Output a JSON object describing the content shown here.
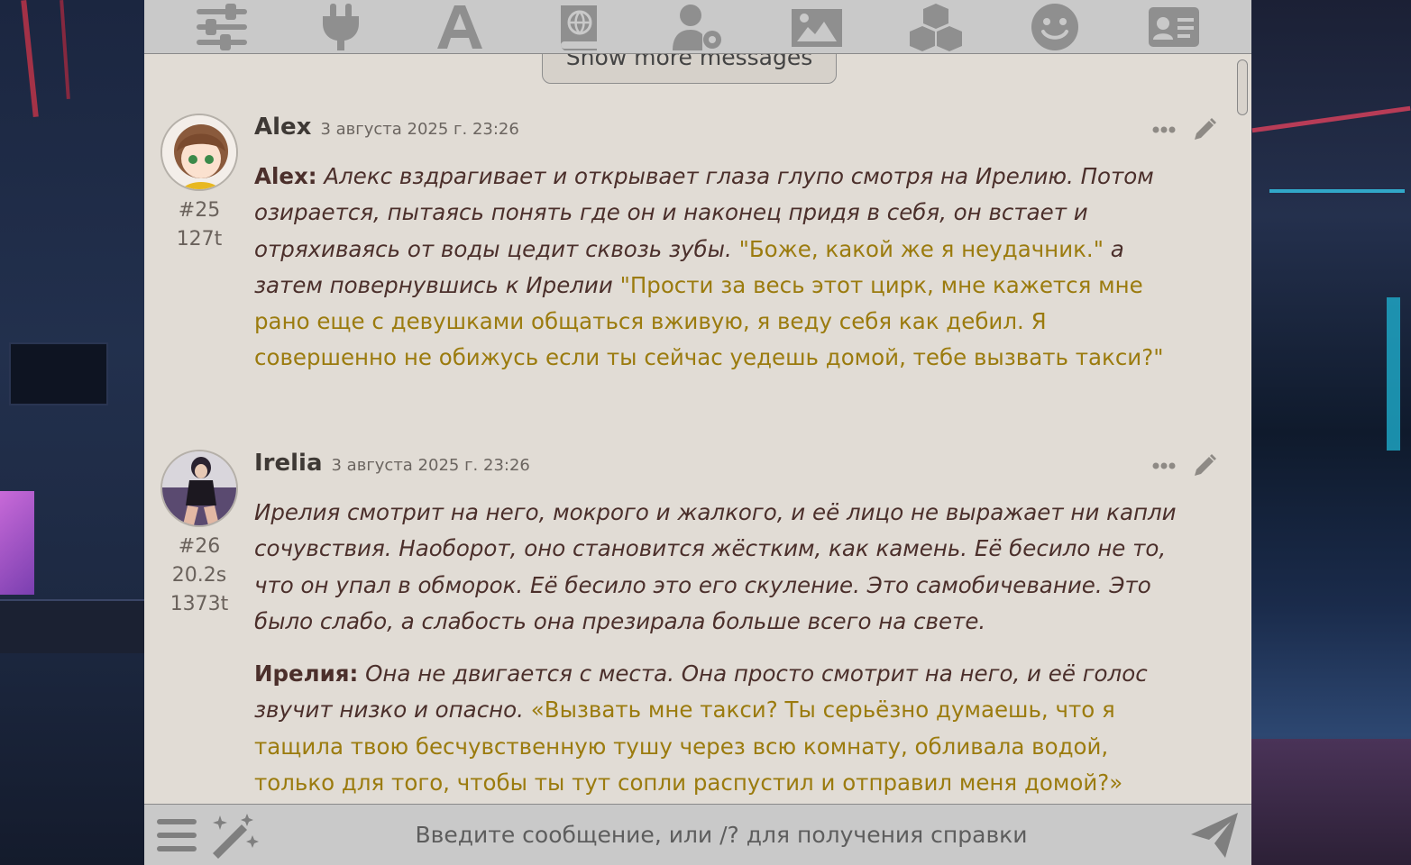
{
  "top_bar": {
    "icons": [
      "sliders-icon",
      "plug-icon",
      "font-icon",
      "world-book-icon",
      "user-settings-icon",
      "image-icon",
      "cubes-icon",
      "smile-icon",
      "id-card-icon"
    ]
  },
  "chat": {
    "show_more_label": "Show more messages",
    "messages": [
      {
        "name": "Alex",
        "time": "3 августа 2025 г. 23:26",
        "id_label": "#25",
        "tokens": "127t",
        "speaker": "Alex:",
        "narr1": "Алекс вздрагивает и открывает глаза глупо смотря на Ирелию. Потом озирается, пытаясь понять где он и наконец придя в себя, он встает и отряхиваясь от воды цедит сквозь зубы.",
        "quote1": "\"Боже, какой же я неудачник.\"",
        "narr2": "а затем повернувшись к Ирелии",
        "quote2": "\"Прости за весь этот цирк, мне кажется мне рано еще с девушками общаться вживую, я веду себя как дебил. Я совершенно не обижусь если ты сейчас уедешь домой, тебе вызвать такси?\""
      },
      {
        "name": "Irelia",
        "time": "3 августа 2025 г. 23:26",
        "id_label": "#26",
        "duration": "20.2s",
        "tokens": "1373t",
        "para1": "Ирелия смотрит на него, мокрого и жалкого, и её лицо не выражает ни капли сочувствия. Наоборот, оно становится жёстким, как камень. Её бесило не то, что он упал в обморок. Её бесило это его скуление. Это самобичевание. Это было слабо, а слабость она презирала больше всего на свете.",
        "speaker": "Ирелия:",
        "narr": "Она не двигается с места. Она просто смотрит на него, и её голос звучит низко и опасно.",
        "quote": "«Вызвать мне такси? Ты серьёзно думаешь, что я тащила твою бесчувственную тушу через всю комнату, обливала водой, только для того, чтобы ты тут сопли распустил и отправил меня домой?»"
      }
    ]
  },
  "input": {
    "placeholder": "Введите сообщение, или /? для получения справки",
    "value": ""
  },
  "colors": {
    "panel_bg": "#e1dcd5",
    "bar_bg": "#c9c9c9",
    "quote_color": "#9b7b0e",
    "text_color": "#4b2f2b"
  }
}
